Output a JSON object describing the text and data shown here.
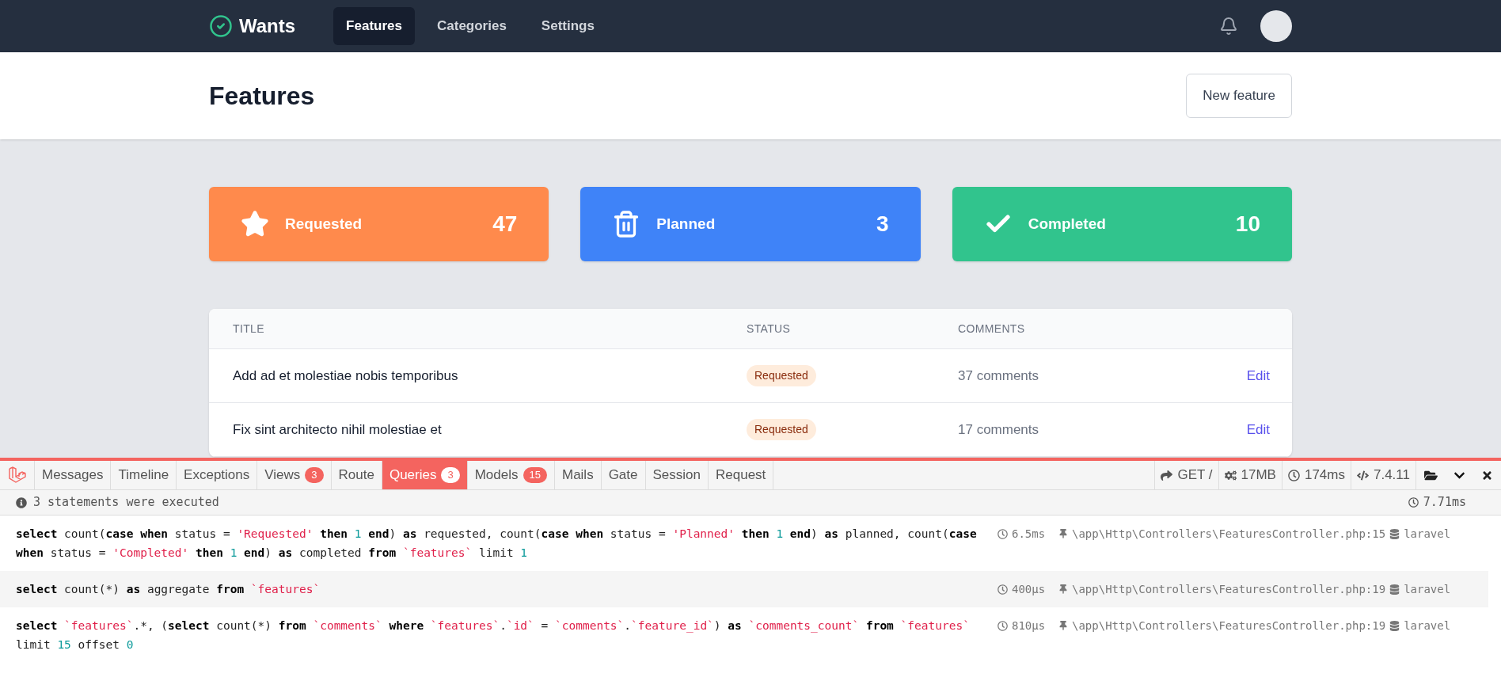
{
  "nav": {
    "brand": "Wants",
    "links": [
      {
        "label": "Features",
        "selected": true
      },
      {
        "label": "Categories",
        "selected": false
      },
      {
        "label": "Settings",
        "selected": false
      }
    ]
  },
  "header": {
    "title": "Features",
    "button": "New feature"
  },
  "stats": [
    {
      "kind": "requested",
      "label": "Requested",
      "count": "47"
    },
    {
      "kind": "planned",
      "label": "Planned",
      "count": "3"
    },
    {
      "kind": "completed",
      "label": "Completed",
      "count": "10"
    }
  ],
  "table": {
    "columns": [
      "TITLE",
      "STATUS",
      "COMMENTS"
    ],
    "rows": [
      {
        "title": "Add ad et molestiae nobis temporibus",
        "status": {
          "label": "Requested",
          "kind": "requested"
        },
        "comments": "37 comments",
        "action": "Edit"
      },
      {
        "title": "Fix sint architecto nihil molestiae et",
        "status": {
          "label": "Requested",
          "kind": "requested"
        },
        "comments": "17 comments",
        "action": "Edit"
      }
    ]
  },
  "debugbar": {
    "tabs": [
      {
        "label": "Messages",
        "selected": false
      },
      {
        "label": "Timeline",
        "selected": false
      },
      {
        "label": "Exceptions",
        "selected": false
      },
      {
        "label": "Views",
        "count": "3",
        "selected": false
      },
      {
        "label": "Route",
        "selected": false
      },
      {
        "label": "Queries",
        "count": "3",
        "selected": true
      },
      {
        "label": "Models",
        "count": "15",
        "selected": false
      },
      {
        "label": "Mails",
        "selected": false
      },
      {
        "label": "Gate",
        "selected": false
      },
      {
        "label": "Session",
        "selected": false
      },
      {
        "label": "Request",
        "selected": false
      }
    ],
    "indicators": [
      {
        "kind": "request",
        "text": "GET /"
      },
      {
        "kind": "memory",
        "text": "17MB"
      },
      {
        "kind": "time",
        "text": "174ms"
      },
      {
        "kind": "version",
        "text": "7.4.11"
      }
    ],
    "summary": "3 statements were executed",
    "total_time": "7.71ms",
    "queries": [
      {
        "time": "6.5ms",
        "source": "\\app\\Http\\Controllers\\FeaturesController.php:15",
        "connection": "laravel",
        "tokens": [
          {
            "kind": "k",
            "text": "select"
          },
          {
            "kind": "t",
            "text": " count("
          },
          {
            "kind": "k",
            "text": "case when"
          },
          {
            "kind": "t",
            "text": " status = "
          },
          {
            "kind": "s",
            "text": "'Requested'"
          },
          {
            "kind": "k",
            "text": " then "
          },
          {
            "kind": "n",
            "text": "1"
          },
          {
            "kind": "k",
            "text": " end"
          },
          {
            "kind": "t",
            "text": ") "
          },
          {
            "kind": "k",
            "text": "as"
          },
          {
            "kind": "t",
            "text": " requested, count("
          },
          {
            "kind": "k",
            "text": "case when"
          },
          {
            "kind": "t",
            "text": " status = "
          },
          {
            "kind": "s",
            "text": "'Planned'"
          },
          {
            "kind": "k",
            "text": " then "
          },
          {
            "kind": "n",
            "text": "1"
          },
          {
            "kind": "k",
            "text": " end"
          },
          {
            "kind": "t",
            "text": ") "
          },
          {
            "kind": "k",
            "text": "as"
          },
          {
            "kind": "t",
            "text": " planned, count("
          },
          {
            "kind": "k",
            "text": "case when"
          },
          {
            "kind": "t",
            "text": " status = "
          },
          {
            "kind": "s",
            "text": "'Completed'"
          },
          {
            "kind": "k",
            "text": " then "
          },
          {
            "kind": "n",
            "text": "1"
          },
          {
            "kind": "k",
            "text": " end"
          },
          {
            "kind": "t",
            "text": ") "
          },
          {
            "kind": "k",
            "text": "as"
          },
          {
            "kind": "t",
            "text": " completed "
          },
          {
            "kind": "k",
            "text": "from "
          },
          {
            "kind": "s",
            "text": "`features`"
          },
          {
            "kind": "t",
            "text": " limit "
          },
          {
            "kind": "n",
            "text": "1"
          }
        ]
      },
      {
        "time": "400μs",
        "source": "\\app\\Http\\Controllers\\FeaturesController.php:19",
        "connection": "laravel",
        "tokens": [
          {
            "kind": "k",
            "text": "select"
          },
          {
            "kind": "t",
            "text": " count(*) "
          },
          {
            "kind": "k",
            "text": "as"
          },
          {
            "kind": "t",
            "text": " aggregate "
          },
          {
            "kind": "k",
            "text": "from "
          },
          {
            "kind": "s",
            "text": "`features`"
          }
        ]
      },
      {
        "time": "810μs",
        "source": "\\app\\Http\\Controllers\\FeaturesController.php:19",
        "connection": "laravel",
        "tokens": [
          {
            "kind": "k",
            "text": "select "
          },
          {
            "kind": "s",
            "text": "`features`"
          },
          {
            "kind": "t",
            "text": ".*, ("
          },
          {
            "kind": "k",
            "text": "select"
          },
          {
            "kind": "t",
            "text": " count(*) "
          },
          {
            "kind": "k",
            "text": "from "
          },
          {
            "kind": "s",
            "text": "`comments`"
          },
          {
            "kind": "k",
            "text": " where "
          },
          {
            "kind": "s",
            "text": "`features`"
          },
          {
            "kind": "t",
            "text": "."
          },
          {
            "kind": "s",
            "text": "`id`"
          },
          {
            "kind": "t",
            "text": " = "
          },
          {
            "kind": "s",
            "text": "`comments`"
          },
          {
            "kind": "t",
            "text": "."
          },
          {
            "kind": "s",
            "text": "`feature_id`"
          },
          {
            "kind": "t",
            "text": ") "
          },
          {
            "kind": "k",
            "text": "as "
          },
          {
            "kind": "s",
            "text": "`comments_count`"
          },
          {
            "kind": "k",
            "text": " from "
          },
          {
            "kind": "s",
            "text": "`features`"
          },
          {
            "kind": "t",
            "text": " limit "
          },
          {
            "kind": "n",
            "text": "15"
          },
          {
            "kind": "t",
            "text": " offset "
          },
          {
            "kind": "n",
            "text": "0"
          }
        ]
      }
    ]
  }
}
